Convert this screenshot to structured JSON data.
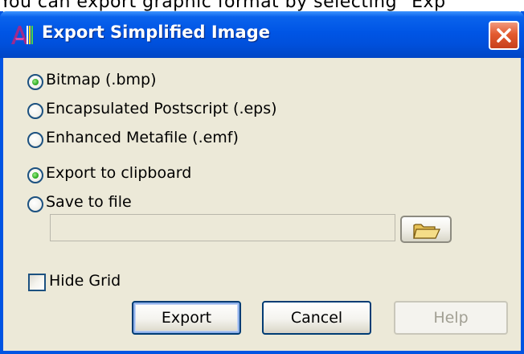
{
  "background_text": "You can export graphic format by selecting \"Exp",
  "window": {
    "title": "Export Simplified Image",
    "close_icon": "close-icon",
    "app_icon": "app-icon"
  },
  "format_options": [
    {
      "label": "Bitmap (.bmp)",
      "selected": true
    },
    {
      "label": "Encapsulated Postscript (.eps)",
      "selected": false
    },
    {
      "label": "Enhanced Metafile (.emf)",
      "selected": false
    }
  ],
  "destination_options": [
    {
      "label": "Export to clipboard",
      "selected": true
    },
    {
      "label": "Save to file",
      "selected": false
    }
  ],
  "file_path": {
    "value": "",
    "placeholder": "",
    "browse_icon": "folder-open-icon"
  },
  "hide_grid": {
    "label": "Hide Grid",
    "checked": false
  },
  "buttons": {
    "export": "Export",
    "cancel": "Cancel",
    "help": "Help"
  },
  "colors": {
    "titlebar": "#0055e5",
    "dialog_bg": "#ece9d8",
    "close_button": "#e35b2f",
    "radio_dot": "#36b22a"
  }
}
